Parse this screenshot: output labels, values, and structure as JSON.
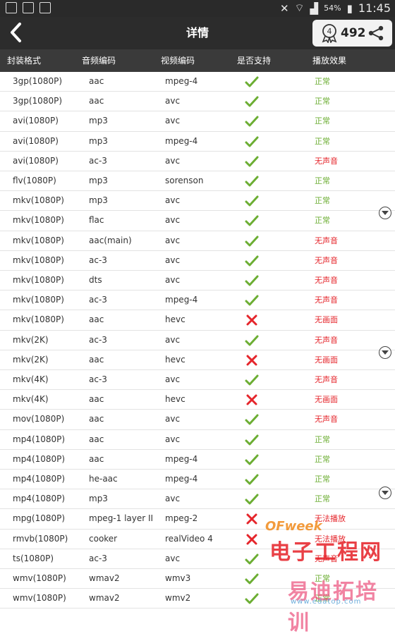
{
  "status_bar": {
    "battery": "54%",
    "time": "11:45"
  },
  "header": {
    "title": "详情",
    "count": "492"
  },
  "columns": [
    "封装格式",
    "音频编码",
    "视频编码",
    "是否支持",
    "播放效果"
  ],
  "rows": [
    {
      "container": "3gp(1080P)",
      "audio": "aac",
      "video": "mpeg-4",
      "supported": true,
      "result": "正常"
    },
    {
      "container": "3gp(1080P)",
      "audio": "aac",
      "video": "avc",
      "supported": true,
      "result": "正常"
    },
    {
      "container": "avi(1080P)",
      "audio": "mp3",
      "video": "avc",
      "supported": true,
      "result": "正常"
    },
    {
      "container": "avi(1080P)",
      "audio": "mp3",
      "video": "mpeg-4",
      "supported": true,
      "result": "正常"
    },
    {
      "container": "avi(1080P)",
      "audio": "ac-3",
      "video": "avc",
      "supported": true,
      "result": "无声音"
    },
    {
      "container": "flv(1080P)",
      "audio": "mp3",
      "video": "sorenson",
      "supported": true,
      "result": "正常"
    },
    {
      "container": "mkv(1080P)",
      "audio": "mp3",
      "video": "avc",
      "supported": true,
      "result": "正常"
    },
    {
      "container": "mkv(1080P)",
      "audio": "flac",
      "video": "avc",
      "supported": true,
      "result": "正常"
    },
    {
      "container": "mkv(1080P)",
      "audio": "aac(main)",
      "video": "avc",
      "supported": true,
      "result": "无声音"
    },
    {
      "container": "mkv(1080P)",
      "audio": "ac-3",
      "video": "avc",
      "supported": true,
      "result": "无声音"
    },
    {
      "container": "mkv(1080P)",
      "audio": "dts",
      "video": "avc",
      "supported": true,
      "result": "无声音"
    },
    {
      "container": "mkv(1080P)",
      "audio": "ac-3",
      "video": "mpeg-4",
      "supported": true,
      "result": "无声音"
    },
    {
      "container": "mkv(1080P)",
      "audio": "aac",
      "video": "hevc",
      "supported": false,
      "result": "无画面"
    },
    {
      "container": "mkv(2K)",
      "audio": "ac-3",
      "video": "avc",
      "supported": true,
      "result": "无声音"
    },
    {
      "container": "mkv(2K)",
      "audio": "aac",
      "video": "hevc",
      "supported": false,
      "result": "无画面"
    },
    {
      "container": "mkv(4K)",
      "audio": "ac-3",
      "video": "avc",
      "supported": true,
      "result": "无声音"
    },
    {
      "container": "mkv(4K)",
      "audio": "aac",
      "video": "hevc",
      "supported": false,
      "result": "无画面"
    },
    {
      "container": "mov(1080P)",
      "audio": "aac",
      "video": "avc",
      "supported": true,
      "result": "无声音"
    },
    {
      "container": "mp4(1080P)",
      "audio": "aac",
      "video": "avc",
      "supported": true,
      "result": "正常"
    },
    {
      "container": "mp4(1080P)",
      "audio": "aac",
      "video": "mpeg-4",
      "supported": true,
      "result": "正常"
    },
    {
      "container": "mp4(1080P)",
      "audio": "he-aac",
      "video": "mpeg-4",
      "supported": true,
      "result": "正常"
    },
    {
      "container": "mp4(1080P)",
      "audio": "mp3",
      "video": "avc",
      "supported": true,
      "result": "正常"
    },
    {
      "container": "mpg(1080P)",
      "audio": "mpeg-1 layer II",
      "video": "mpeg-2",
      "supported": false,
      "result": "无法播放"
    },
    {
      "container": "rmvb(1080P)",
      "audio": "cooker",
      "video": "realVideo 4",
      "supported": false,
      "result": "无法播放"
    },
    {
      "container": "ts(1080P)",
      "audio": "ac-3",
      "video": "avc",
      "supported": true,
      "result": "无声音"
    },
    {
      "container": "wmv(1080P)",
      "audio": "wmav2",
      "video": "wmv3",
      "supported": true,
      "result": "正常"
    },
    {
      "container": "wmv(1080P)",
      "audio": "wmav2",
      "video": "wmv2",
      "supported": true,
      "result": "正常"
    }
  ],
  "watermark": {
    "brand": "OFweek",
    "line1": "电子工程网",
    "line2": "易迪拓培训",
    "url": "www.edatop.com"
  },
  "colors": {
    "ok": "#6cae33",
    "bad": "#e5252b",
    "header_bg": "#2c2c2c"
  }
}
